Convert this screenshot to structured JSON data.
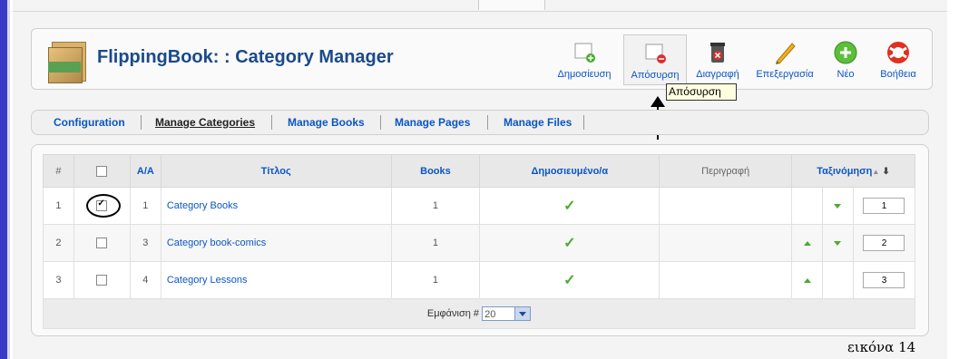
{
  "top_tab": "",
  "header": {
    "title": "FlippingBook: : Category Manager",
    "toolbar": [
      {
        "label": "Δημοσίευση",
        "icon": "publish-icon"
      },
      {
        "label": "Απόσυρση",
        "icon": "unpublish-icon"
      },
      {
        "label": "Διαγραφή",
        "icon": "delete-icon"
      },
      {
        "label": "Επεξεργασία",
        "icon": "edit-icon"
      },
      {
        "label": "Νέο",
        "icon": "new-icon"
      },
      {
        "label": "Βοήθεια",
        "icon": "help-icon"
      }
    ]
  },
  "tooltip": "Απόσυρση",
  "submenu": {
    "items": [
      "Configuration",
      "Manage Categories",
      "Manage Books",
      "Manage Pages",
      "Manage Files"
    ],
    "current": "Manage Categories"
  },
  "table": {
    "headers": {
      "num": "#",
      "aa": "A/A",
      "title": "Τίτλος",
      "books": "Books",
      "published": "Δημοσιευμένο/α",
      "description": "Περιγραφή",
      "ordering": "Ταξινόμηση"
    },
    "rows": [
      {
        "num": "1",
        "aa": "1",
        "title": "Category Books",
        "books": "1",
        "published": true,
        "order": "1",
        "checked": true,
        "up": false,
        "down": true
      },
      {
        "num": "2",
        "aa": "3",
        "title": "Category book-comics",
        "books": "1",
        "published": true,
        "order": "2",
        "checked": false,
        "up": true,
        "down": true
      },
      {
        "num": "3",
        "aa": "4",
        "title": "Category Lessons",
        "books": "1",
        "published": true,
        "order": "3",
        "checked": false,
        "up": true,
        "down": false
      }
    ],
    "footer": {
      "display_label": "Εμφάνιση #",
      "display_value": "20"
    }
  },
  "caption": "εικόνα 14",
  "colors": {
    "link": "#0b55c4",
    "check": "#4caa30",
    "title": "#1a4a8a"
  }
}
